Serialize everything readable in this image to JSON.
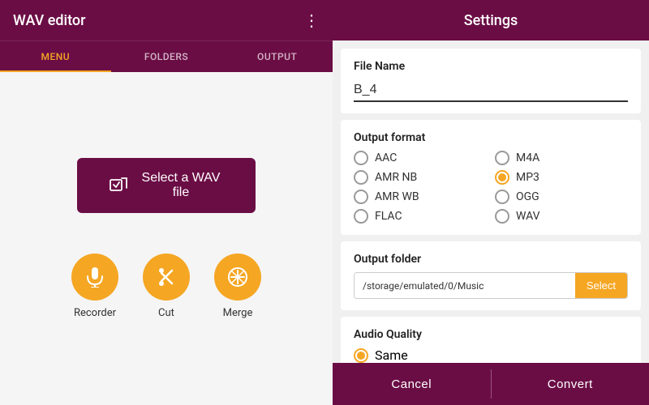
{
  "left": {
    "header": {
      "title": "WAV editor",
      "more_icon": "⋮"
    },
    "tabs": [
      {
        "id": "menu",
        "label": "MENU",
        "active": true
      },
      {
        "id": "folders",
        "label": "FOLDERS",
        "active": false
      },
      {
        "id": "output",
        "label": "OUTPUT",
        "active": false
      }
    ],
    "select_btn": {
      "label": "Select a WAV file",
      "icon": "⊡"
    },
    "actions": [
      {
        "id": "recorder",
        "label": "Recorder",
        "icon": "🎤"
      },
      {
        "id": "cut",
        "label": "Cut",
        "icon": "✂"
      },
      {
        "id": "merge",
        "label": "Merge",
        "icon": "⊕"
      }
    ]
  },
  "right": {
    "header": {
      "title": "Settings"
    },
    "file_name": {
      "label": "File Name",
      "value": "B_4"
    },
    "output_format": {
      "label": "Output format",
      "options": [
        {
          "id": "aac",
          "label": "AAC",
          "selected": false
        },
        {
          "id": "m4a",
          "label": "M4A",
          "selected": false
        },
        {
          "id": "amr_nb",
          "label": "AMR NB",
          "selected": false
        },
        {
          "id": "mp3",
          "label": "MP3",
          "selected": true
        },
        {
          "id": "amr_wb",
          "label": "AMR WB",
          "selected": false
        },
        {
          "id": "ogg",
          "label": "OGG",
          "selected": false
        },
        {
          "id": "flac",
          "label": "FLAC",
          "selected": false
        },
        {
          "id": "wav",
          "label": "WAV",
          "selected": false
        }
      ]
    },
    "output_folder": {
      "label": "Output folder",
      "path": "/storage/emulated/0/Music",
      "select_btn_label": "Select"
    },
    "audio_quality": {
      "label": "Audio Quality",
      "options": [
        {
          "id": "same",
          "label": "Same",
          "selected": true
        }
      ]
    },
    "footer": {
      "cancel_label": "Cancel",
      "convert_label": "Convert"
    }
  }
}
